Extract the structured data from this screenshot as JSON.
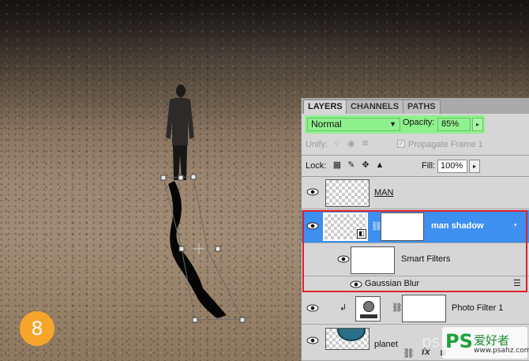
{
  "step": {
    "number": "8"
  },
  "panel": {
    "tabs": [
      {
        "label": "LAYERS"
      },
      {
        "label": "CHANNELS"
      },
      {
        "label": "PATHS"
      }
    ],
    "blend_mode": "Normal",
    "opacity_label": "Opacity:",
    "opacity_value": "85%",
    "unify_label": "Unify:",
    "propagate_label": "Propagate Frame 1",
    "lock_label": "Lock:",
    "fill_label": "Fill:",
    "fill_value": "100%",
    "layers": [
      {
        "name": "MAN"
      },
      {
        "name": "man shadow"
      },
      {
        "name": "Smart Filters"
      },
      {
        "name": "Gaussian Blur"
      },
      {
        "name": "Photo Filter 1"
      },
      {
        "name": "planet"
      }
    ],
    "footer_icons": [
      "link-icon",
      "fx-icon",
      "mask-icon"
    ]
  },
  "watermark": {
    "text": "ps",
    "logo_mark": "PS",
    "logo_text": "爱好者",
    "logo_url": "www.psahz.com"
  },
  "colors": {
    "highlight_green": "#8ff18d",
    "selected_blue": "#3d8ff0",
    "annotation_red": "#e2202a",
    "badge_orange": "#f7a52a"
  }
}
